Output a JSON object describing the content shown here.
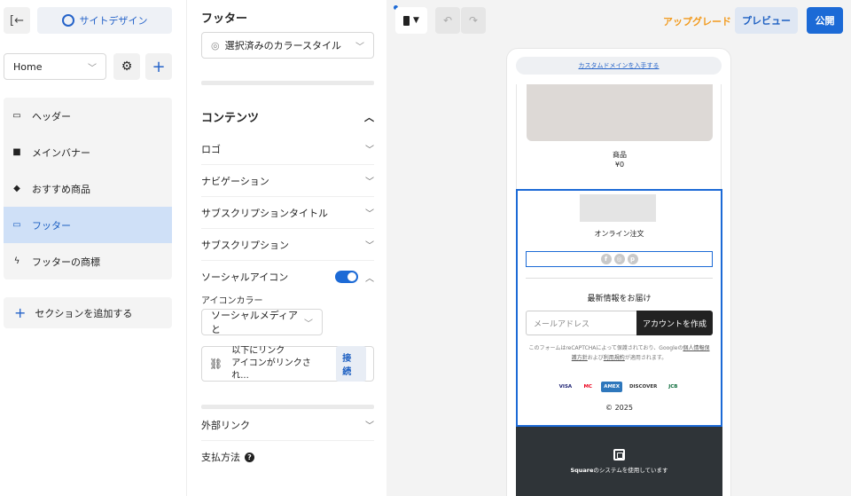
{
  "sidebar": {
    "back_icon": "exit-panel-icon",
    "site_design_label": "サイトデザイン",
    "page_select_value": "Home",
    "sections": [
      {
        "label": "ヘッダー",
        "icon": "header-icon"
      },
      {
        "label": "メインバナー",
        "icon": "bookmark-icon"
      },
      {
        "label": "おすすめ商品",
        "icon": "tag-icon"
      },
      {
        "label": "フッター",
        "icon": "footer-icon",
        "active": true
      },
      {
        "label": "フッターの商標",
        "icon": "bolt-icon"
      }
    ],
    "add_section_label": "セクションを追加する"
  },
  "panel": {
    "title": "フッター",
    "color_style_value": "選択済みのカラースタイル",
    "contents_heading": "コンテンツ",
    "rows": [
      {
        "label": "ロゴ"
      },
      {
        "label": "ナビゲーション"
      },
      {
        "label": "サブスクリプションタイトル"
      },
      {
        "label": "サブスクリプション"
      }
    ],
    "social_row_label": "ソーシャルアイコン",
    "social_toggle_on": true,
    "icon_color_label": "アイコンカラー",
    "icon_color_value": "ソーシャルメディアと",
    "link_box_line1": "以下にリンク",
    "link_box_line2": "アイコンがリンクされ...",
    "connect_label": "接続",
    "external_links_label": "外部リンク",
    "payment_label": "支払方法",
    "payment_help": "?"
  },
  "topbar": {
    "undo_icon": "undo-icon",
    "redo_icon": "redo-icon",
    "upgrade_label": "アップグレード",
    "preview_label": "プレビュー",
    "publish_label": "公開"
  },
  "preview": {
    "custom_domain_label": "カスタムドメインを入手する",
    "product_name": "商品",
    "product_price": "¥0",
    "online_order": "オンライン注文",
    "newsletter_title": "最新情報をお届け",
    "email_placeholder": "メールアドレス",
    "create_account_label": "アカウントを作成",
    "recaptcha_text_1": "このフォームはreCAPTCHAによって保護されており、Googleの",
    "recaptcha_link_1": "個人情報保護方針",
    "recaptcha_text_2": "および",
    "recaptcha_link_2": "利用規約",
    "recaptcha_text_3": "が適用されます。",
    "payment_icons": [
      "VISA",
      "MC",
      "AMEX",
      "DISCOVER",
      "JCB"
    ],
    "copyright": "© 2025",
    "square_brand": "Square",
    "square_suffix": "のシステムを使用しています"
  },
  "colors": {
    "accent": "#1c6ad6",
    "upgrade": "#f29a1d",
    "active_bg": "#cfe0f7",
    "footer_dark": "#2f3438"
  }
}
